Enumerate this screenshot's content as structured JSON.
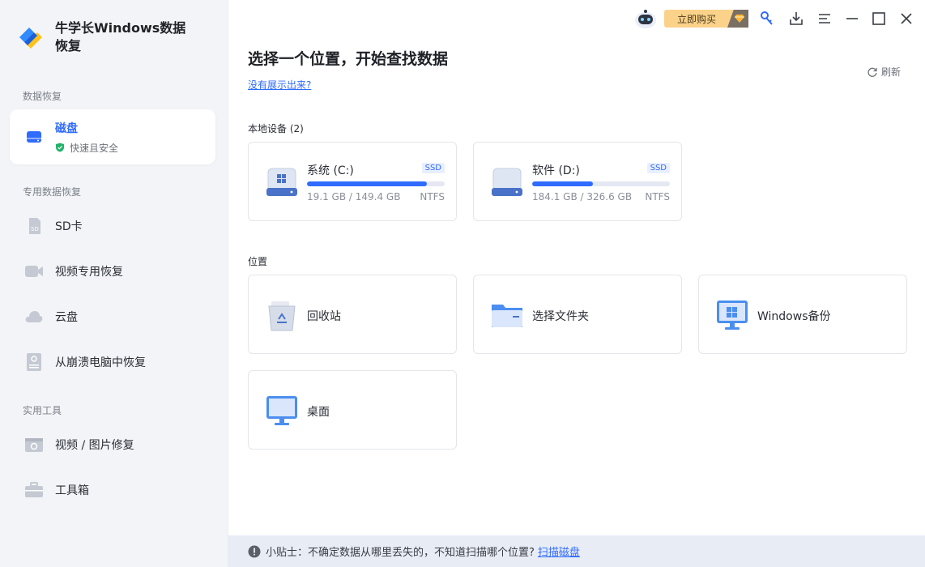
{
  "app": {
    "name": "牛学长Windows数据恢复"
  },
  "sidebar": {
    "sections": [
      {
        "title": "数据恢复"
      },
      {
        "title": "专用数据恢复"
      },
      {
        "title": "实用工具"
      }
    ],
    "active": {
      "label": "磁盘",
      "sub": "快速且安全"
    },
    "items": [
      {
        "label": "SD卡",
        "icon": "sd-card-icon"
      },
      {
        "label": "视频专用恢复",
        "icon": "video-camera-icon"
      },
      {
        "label": "云盘",
        "icon": "cloud-icon"
      },
      {
        "label": "从崩溃电脑中恢复",
        "icon": "crashed-pc-icon"
      },
      {
        "label": "视频 / 图片修复",
        "icon": "photo-repair-icon"
      },
      {
        "label": "工具箱",
        "icon": "toolbox-icon"
      }
    ]
  },
  "topbar": {
    "buy_label": "立即购买"
  },
  "main": {
    "title": "选择一个位置，开始查找数据",
    "help_link": "没有展示出来?",
    "refresh_label": "刷新",
    "local_devices_label": "本地设备 (2)",
    "locations_label": "位置",
    "drives": [
      {
        "name": "系统 (C:)",
        "badge": "SSD",
        "usage": "19.1 GB / 149.4 GB",
        "fs": "NTFS",
        "used_fraction": 0.87
      },
      {
        "name": "软件 (D:)",
        "badge": "SSD",
        "usage": "184.1 GB / 326.6 GB",
        "fs": "NTFS",
        "used_fraction": 0.44
      }
    ],
    "locations": [
      {
        "name": "回收站",
        "icon": "recycle-bin-icon"
      },
      {
        "name": "选择文件夹",
        "icon": "folder-icon"
      },
      {
        "name": "Windows备份",
        "icon": "windows-backup-icon"
      },
      {
        "name": "桌面",
        "icon": "desktop-monitor-icon"
      }
    ]
  },
  "tip": {
    "text": "小贴士：不确定数据从哪里丢失的，不知道扫描哪个位置?",
    "link": "扫描磁盘"
  },
  "colors": {
    "accent": "#2f6bff",
    "sidebar_bg": "#f3f4f7",
    "buy_bg": "#fbd28a",
    "tip_bg": "#e8ecf5"
  }
}
